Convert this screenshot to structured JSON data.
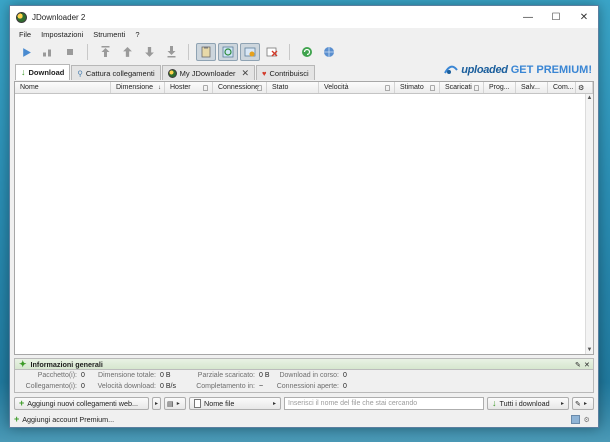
{
  "window": {
    "title": "JDownloader 2"
  },
  "window_controls": {
    "minimize": "—",
    "maximize": "☐",
    "close": "✕"
  },
  "menu": [
    "File",
    "Impostazioni",
    "Strumenti",
    "?"
  ],
  "tabs": [
    {
      "label": "Download"
    },
    {
      "label": "Cattura collegamenti"
    },
    {
      "label": "My JDownloader"
    },
    {
      "label": "Contribuisci"
    }
  ],
  "promo": {
    "logo": "uploaded",
    "cta": "GET PREMIUM!"
  },
  "columns": [
    "Nome",
    "Dimensione",
    "Hoster",
    "Connessione",
    "Stato",
    "Velocità",
    "Stimato",
    "Scaricati",
    "Prog...",
    "Salv...",
    "Com..."
  ],
  "info_panel": {
    "title": "Informazioni generali",
    "row1": [
      {
        "label": "Pacchetto(i):",
        "value": "0"
      },
      {
        "label": "Dimensione totale:",
        "value": "0 B"
      },
      {
        "label": "Parziale scaricato:",
        "value": "0 B"
      },
      {
        "label": "Download in corso:",
        "value": "0"
      }
    ],
    "row2": [
      {
        "label": "Collegamento(i):",
        "value": "0"
      },
      {
        "label": "Velocità download:",
        "value": "0 B/s"
      },
      {
        "label": "Completamento in:",
        "value": "~"
      },
      {
        "label": "Connessioni aperte:",
        "value": "0"
      }
    ]
  },
  "bottom_bar": {
    "add_links": "Aggiungi nuovi collegamenti web...",
    "filter_type": "Nome file",
    "search_placeholder": "Inserisci il nome del file che stai cercando",
    "filter_all": "Tutti i download"
  },
  "status_bar": {
    "add_account": "Aggiungi account Premium..."
  },
  "colors": {
    "accent_green": "#3c9b27",
    "promo_blue": "#3a86d4",
    "desktop": "#2a8db3"
  }
}
